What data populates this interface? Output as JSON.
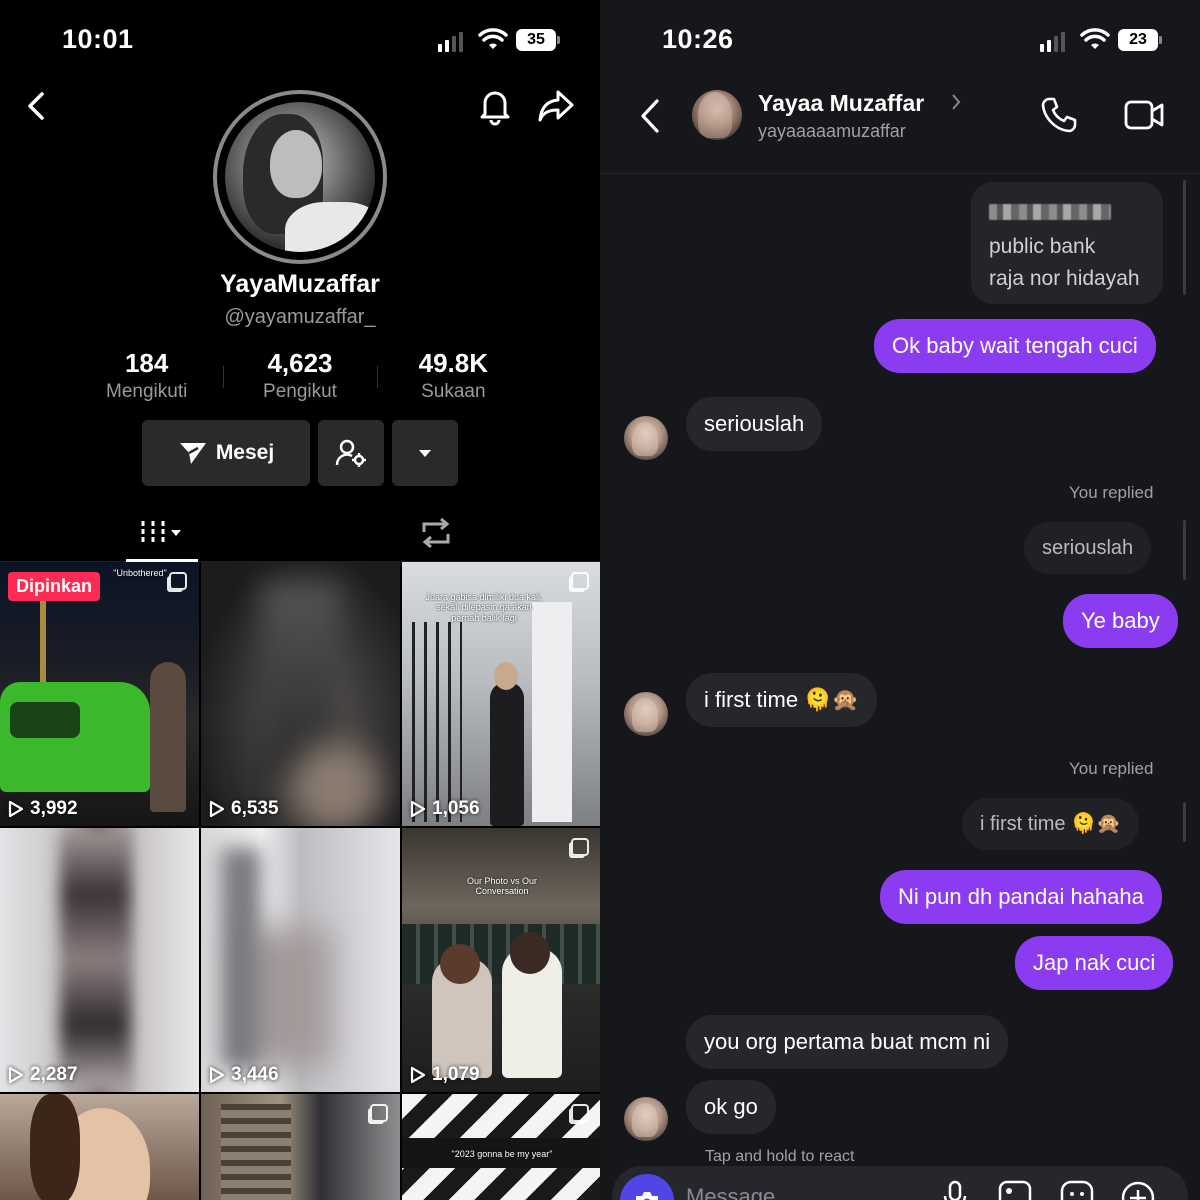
{
  "left": {
    "status": {
      "time": "10:01",
      "battery": "35"
    },
    "profile": {
      "display_name": "YayaMuzaffar",
      "handle": "@yayamuzaffar_",
      "stats": [
        {
          "value": "184",
          "label": "Mengikuti"
        },
        {
          "value": "4,623",
          "label": "Pengikut"
        },
        {
          "value": "49.8K",
          "label": "Sukaan"
        }
      ],
      "message_button": "Mesej"
    },
    "grid": [
      {
        "views": "3,992",
        "pinned_label": "Dipinkan",
        "caption": "\"Unbothered\""
      },
      {
        "views": "6,535"
      },
      {
        "views": "1,056",
        "caption": "Juara gabisa dimiliki dua kali, sekali dilepasin ga akan pernah balik lagi"
      },
      {
        "views": "2,287"
      },
      {
        "views": "3,446"
      },
      {
        "views": "1,079",
        "caption": "Our Photo vs Our Conversation"
      },
      {
        "views": ""
      },
      {
        "views": ""
      },
      {
        "views": "",
        "caption": "\"2023 gonna be my year\""
      }
    ]
  },
  "right": {
    "status": {
      "time": "10:26",
      "battery": "23"
    },
    "header": {
      "name": "Yayaa Muzaffar",
      "username": "yayaaaaamuzaffar"
    },
    "messages": {
      "m1_line2": "public bank",
      "m1_line3": "raja nor hidayah",
      "m2": "Ok baby wait tengah cuci",
      "m3": "seriouslah",
      "replied1_label": "You replied",
      "replied1_quote": "seriouslah",
      "m4": "Ye baby",
      "m5": "i first time 🫠🙊",
      "replied2_label": "You replied",
      "replied2_quote": "i first time 🫠🙊",
      "m6": "Ni pun dh pandai hahaha",
      "m7": "Jap nak cuci",
      "m8": "you org pertama buat mcm ni",
      "m9": "ok go",
      "hint": "Tap and hold to react"
    },
    "composer": {
      "placeholder": "Message"
    }
  }
}
